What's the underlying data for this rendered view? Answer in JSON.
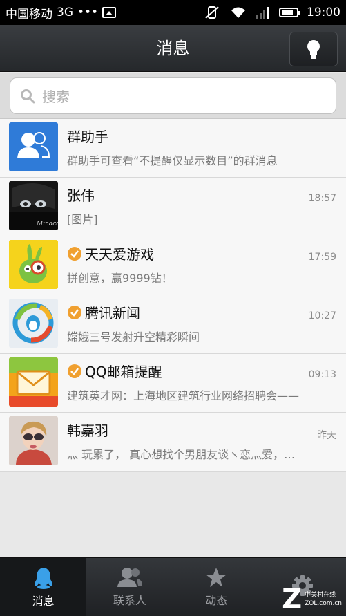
{
  "status_bar": {
    "carrier": "中国移动",
    "network": "3G",
    "dots": "•••",
    "time": "19:00"
  },
  "header": {
    "title": "消息"
  },
  "search": {
    "placeholder": "搜索"
  },
  "conversations": [
    {
      "name": "群助手",
      "message": "群助手可查看“不提醒仅显示数目”的群消息",
      "time": "",
      "verified": false
    },
    {
      "name": "张伟",
      "message": "[图片]",
      "time": "18:57",
      "verified": false,
      "avatar_text": "Minaco"
    },
    {
      "name": "天天爱游戏",
      "message": "拼创意，赢9999钻！",
      "time": "17:59",
      "verified": true
    },
    {
      "name": "腾讯新闻",
      "message": "嫦娥三号发射升空精彩瞬间",
      "time": "10:27",
      "verified": true
    },
    {
      "name": "QQ邮箱提醒",
      "message": "建筑英才网：上海地区建筑行业网络招聘会——",
      "time": "09:13",
      "verified": true
    },
    {
      "name": "韩嘉羽",
      "message": "灬 玩累了， 真心想找个男朋友谈ヽ恋灬爱，…",
      "time": "昨天",
      "verified": false
    }
  ],
  "tabs": [
    {
      "label": "消息",
      "icon": "qq-penguin-icon",
      "active": true
    },
    {
      "label": "联系人",
      "icon": "contacts-icon",
      "active": false
    },
    {
      "label": "动态",
      "icon": "star-icon",
      "active": false
    },
    {
      "label": "",
      "icon": "gear-icon",
      "active": false
    }
  ],
  "watermark": {
    "line1": "中关村在线",
    "line2": "ZOL.com.cn"
  },
  "colors": {
    "verified_badge": "#f0a030",
    "group_helper_bg": "#2f7bd8",
    "active_tab_bg": "#16181a"
  }
}
